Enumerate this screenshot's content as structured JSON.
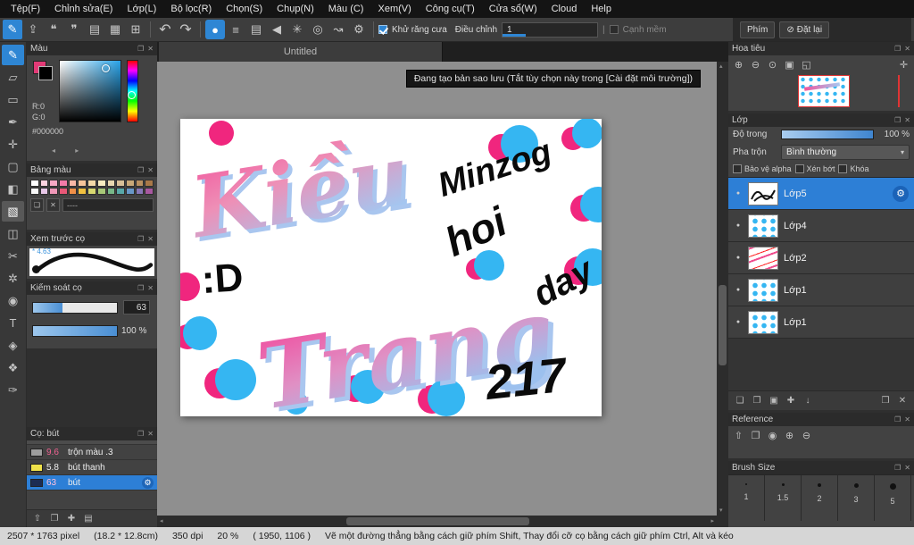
{
  "colors": {
    "accent_blue": "#2e86d4",
    "selection_blue": "#2d7fd6",
    "dot_blue": "#35b6f2",
    "dot_pink": "#f0267e",
    "foreground_color": "#000000",
    "background_color": "#e23a76"
  },
  "menubar": {
    "items": [
      "Tệp(F)",
      "Chỉnh sửa(E)",
      "Lớp(L)",
      "Bộ lọc(R)",
      "Chọn(S)",
      "Chụp(N)",
      "Màu (C)",
      "Xem(V)",
      "Công cụ(T)",
      "Cửa sổ(W)",
      "Cloud",
      "Help"
    ]
  },
  "ui": {
    "popout_icon": "❐",
    "close_icon": "✕",
    "gear_icon": "⚙",
    "dropdown_arrow": "▾",
    "eye_dot": "●",
    "scroll_up": "▴",
    "scroll_down": "▾",
    "scroll_left": "◂",
    "scroll_right": "▸",
    "separator": "|",
    "color_arrows": "◂ ▸"
  },
  "toolbar": {
    "pen_icon": "✎",
    "left_icons": [
      "⇪",
      "❝",
      "❞",
      "▤",
      "▦",
      "⊞"
    ],
    "undo_icon": "↶",
    "redo_icon": "↷",
    "brush_icons": [
      "●",
      "≡",
      "▤",
      "◀",
      "✳",
      "◎",
      "↝",
      "⚙"
    ],
    "antialias_label": "Khử răng cưa",
    "adjust_label": "Điều chỉnh",
    "adjust_value": "1",
    "soft_edge_label": "Cạnh mềm",
    "key_button": "Phím",
    "reset_icon": "⊘",
    "reset_button": "Đặt lại"
  },
  "tools": {
    "glyphs": [
      "✎",
      "▱",
      "▭",
      "✒",
      "✛",
      "▢",
      "◧",
      "▧",
      "◫",
      "✂",
      "✲",
      "◉",
      "T",
      "◈",
      "❖",
      "✑"
    ]
  },
  "color_panel": {
    "title": "Màu",
    "r_label": "R:0",
    "g_label": "G:0",
    "hex": "#000000"
  },
  "palette_panel": {
    "title": "Bảng màu",
    "field": "----",
    "new_icon": "❏",
    "delete_icon": "✕",
    "row1": [
      "#ffffff",
      "#fbd3e0",
      "#f7a8c4",
      "#f27aa8",
      "#f9b7a5",
      "#f6c59a",
      "#f3d9a8",
      "#f7ecc0",
      "#e8d8b0",
      "#d8c098",
      "#c8a878",
      "#b89060",
      "#a87848"
    ],
    "row2": [
      "#f8f8f8",
      "#e8c8e8",
      "#f098b8",
      "#e85878",
      "#f09048",
      "#f0c040",
      "#d8d870",
      "#a8c878",
      "#78b888",
      "#58a8a8",
      "#6898c8",
      "#8878b8",
      "#a858a0"
    ]
  },
  "preview_panel": {
    "title": "Xem trước cọ",
    "size_label": "* 4.63"
  },
  "control_panel": {
    "title": "Kiểm soát cọ",
    "size_value": "63",
    "opacity_value": "100 %"
  },
  "brush_panel": {
    "title": "Cọ: bút",
    "bar_icons": [
      "⇧",
      "❐",
      "✚",
      "▤"
    ],
    "items": [
      {
        "size": "9.6",
        "name": "trộn màu .3"
      },
      {
        "size": "5.8",
        "name": "bút thanh"
      },
      {
        "size": "63",
        "name": "bút"
      }
    ]
  },
  "canvas": {
    "tab": "Untitled",
    "tooltip": "Đang tạo bản sao lưu (Tắt tùy chọn này trong [Cài đặt môi trường])"
  },
  "artwork": {
    "word_top": "Kiều",
    "word_bottom": "Trang",
    "emoticon": ":D",
    "script1": "Minzog",
    "script2": "hoi",
    "script3": "day",
    "number": "217"
  },
  "navigator": {
    "title": "Hoa tiêu",
    "icons": [
      "⊕",
      "⊖",
      "⊙",
      "▣",
      "◱"
    ],
    "hand_icon": "✛"
  },
  "layers_panel": {
    "title": "Lớp",
    "opacity_label": "Độ trong",
    "opacity_value": "100 %",
    "blend_label": "Pha trộn",
    "blend_value": "Bình thường",
    "check_alpha": "Bảo vệ alpha",
    "check_clip": "Xén bớt",
    "check_lock": "Khóa",
    "bar_icons": [
      "❏",
      "❐",
      "▣",
      "✚",
      "↓"
    ],
    "bar_right_icons": [
      "❒",
      "✕"
    ],
    "items": [
      {
        "name": "Lớp5"
      },
      {
        "name": "Lớp4"
      },
      {
        "name": "Lớp2"
      },
      {
        "name": "Lớp1"
      },
      {
        "name": "Lớp1"
      }
    ]
  },
  "reference_panel": {
    "title": "Reference",
    "icons": [
      "⇧",
      "❐",
      "◉",
      "⊕",
      "⊖"
    ]
  },
  "brush_size_panel": {
    "title": "Brush Size",
    "sizes": [
      "1",
      "1.5",
      "2",
      "3",
      "5"
    ]
  },
  "statusbar": {
    "dimensions": "2507 * 1763 pixel",
    "size_cm": "(18.2 * 12.8cm)",
    "dpi": "350 dpi",
    "zoom": "20 %",
    "coords": "( 1950, 1106 )",
    "hint": "Vẽ một đường thẳng bằng cách giữ phím Shift, Thay đổi cỡ cọ bằng cách giữ phím Ctrl, Alt và kéo"
  }
}
